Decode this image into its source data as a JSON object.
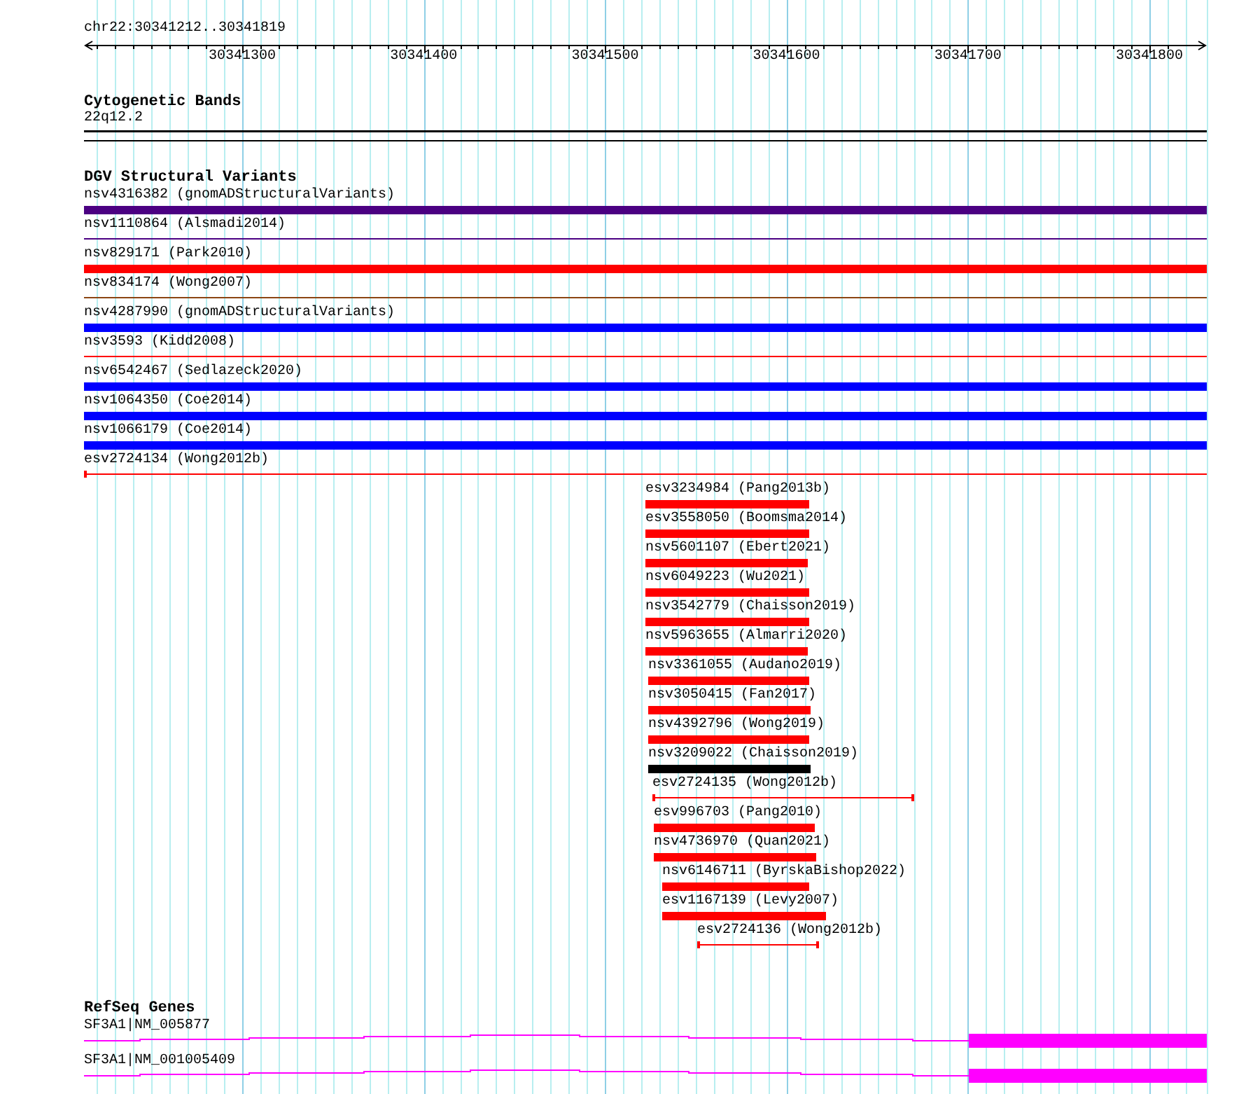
{
  "ruler": {
    "range": "chr22:30341212..30341819",
    "ticks": [
      "30341300",
      "30341400",
      "30341500",
      "30341600",
      "30341700",
      "30341800"
    ]
  },
  "tracks": [
    {
      "title": "Cytogenetic Bands",
      "kind": "bands",
      "features": [
        {
          "label": "22q12.2"
        }
      ]
    },
    {
      "title": "DGV Structural Variants",
      "kind": "variants",
      "features": [
        {
          "label": "nsv4316382 (gnomADStructuralVariants)",
          "kind": "thick",
          "color": "#4b0082"
        },
        {
          "label": "nsv1110864 (Alsmadi2014)",
          "kind": "thin",
          "color": "#4b0082"
        },
        {
          "label": "nsv829171 (Park2010)",
          "kind": "thick",
          "color": "#ff0000"
        },
        {
          "label": "nsv834174 (Wong2007)",
          "kind": "thin",
          "color": "#8b4513"
        },
        {
          "label": "nsv4287990 (gnomADStructuralVariants)",
          "kind": "thick",
          "color": "#0000ff"
        },
        {
          "label": "nsv3593 (Kidd2008)",
          "kind": "thin",
          "color": "#ff0000"
        },
        {
          "label": "nsv6542467 (Sedlazeck2020)",
          "kind": "thick",
          "color": "#0000ff"
        },
        {
          "label": "nsv1064350 (Coe2014)",
          "kind": "thick",
          "color": "#0000ff"
        },
        {
          "label": "nsv1066179 (Coe2014)",
          "kind": "thick",
          "color": "#0000ff"
        },
        {
          "label": "esv2724134 (Wong2012b)",
          "kind": "bracket",
          "color": "#ff0000"
        },
        {
          "label": "esv3234984 (Pang2013b)",
          "kind": "thick",
          "color": "#ff0000"
        },
        {
          "label": "esv3558050 (Boomsma2014)",
          "kind": "thick",
          "color": "#ff0000"
        },
        {
          "label": "nsv5601107 (Ebert2021)",
          "kind": "thick",
          "color": "#ff0000"
        },
        {
          "label": "nsv6049223 (Wu2021)",
          "kind": "thick",
          "color": "#ff0000"
        },
        {
          "label": "nsv3542779 (Chaisson2019)",
          "kind": "thick",
          "color": "#ff0000"
        },
        {
          "label": "nsv5963655 (Almarri2020)",
          "kind": "thick",
          "color": "#ff0000"
        },
        {
          "label": "nsv3361055 (Audano2019)",
          "kind": "thick",
          "color": "#ff0000"
        },
        {
          "label": "nsv3050415 (Fan2017)",
          "kind": "thick",
          "color": "#ff0000"
        },
        {
          "label": "nsv4392796 (Wong2019)",
          "kind": "thick",
          "color": "#ff0000"
        },
        {
          "label": "nsv3209022 (Chaisson2019)",
          "kind": "thick",
          "color": "#000000"
        },
        {
          "label": "esv2724135 (Wong2012b)",
          "kind": "bracket",
          "color": "#ff0000"
        },
        {
          "label": "esv996703 (Pang2010)",
          "kind": "thick",
          "color": "#ff0000"
        },
        {
          "label": "nsv4736970 (Quan2021)",
          "kind": "thick",
          "color": "#ff0000"
        },
        {
          "label": "nsv6146711 (ByrskaBishop2022)",
          "kind": "thick",
          "color": "#ff0000"
        },
        {
          "label": "esv1167139 (Levy2007)",
          "kind": "thick",
          "color": "#ff0000"
        },
        {
          "label": "esv2724136 (Wong2012b)",
          "kind": "bracket",
          "color": "#ff0000"
        }
      ]
    },
    {
      "title": "RefSeq Genes",
      "kind": "genes",
      "features": [
        {
          "label": "SF3A1|NM_005877"
        },
        {
          "label": "SF3A1|NM_001005409"
        }
      ]
    }
  ]
}
